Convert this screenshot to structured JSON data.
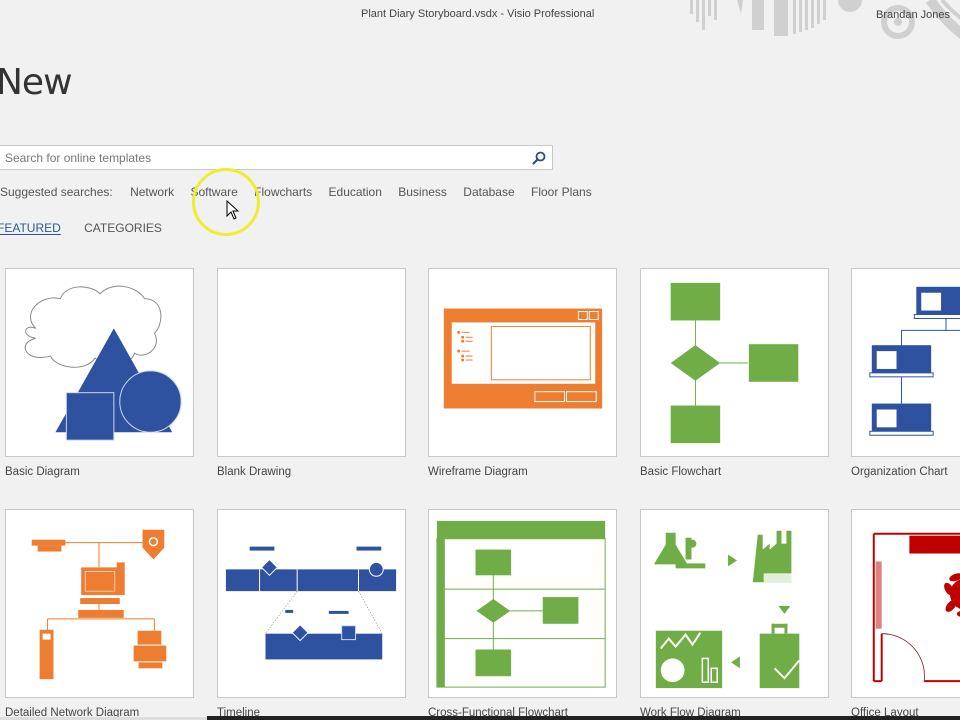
{
  "window": {
    "title": "Plant Diary Storyboard.vsdx  -  Visio Professional",
    "user_name": "Brandan Jones"
  },
  "page": {
    "heading": "New"
  },
  "search": {
    "placeholder": "Search for online templates",
    "value": "",
    "icon": "search-icon"
  },
  "suggested": {
    "label": "Suggested searches:",
    "items": [
      "Network",
      "Software",
      "Flowcharts",
      "Education",
      "Business",
      "Database",
      "Floor Plans"
    ]
  },
  "tabs": [
    {
      "label": "FEATURED",
      "active": true
    },
    {
      "label": "CATEGORIES",
      "active": false
    }
  ],
  "colors": {
    "blue": "#2f52a0",
    "orange": "#ed7d31",
    "green": "#70ad47",
    "red": "#c00000",
    "accent": "#2b579a"
  },
  "templates": [
    {
      "label": "Basic Diagram"
    },
    {
      "label": "Blank Drawing"
    },
    {
      "label": "Wireframe Diagram"
    },
    {
      "label": "Basic Flowchart"
    },
    {
      "label": "Organization Chart"
    },
    {
      "label": "Detailed Network Diagram"
    },
    {
      "label": "Timeline"
    },
    {
      "label": "Cross-Functional Flowchart"
    },
    {
      "label": "Work Flow Diagram"
    },
    {
      "label": "Office Layout"
    }
  ]
}
